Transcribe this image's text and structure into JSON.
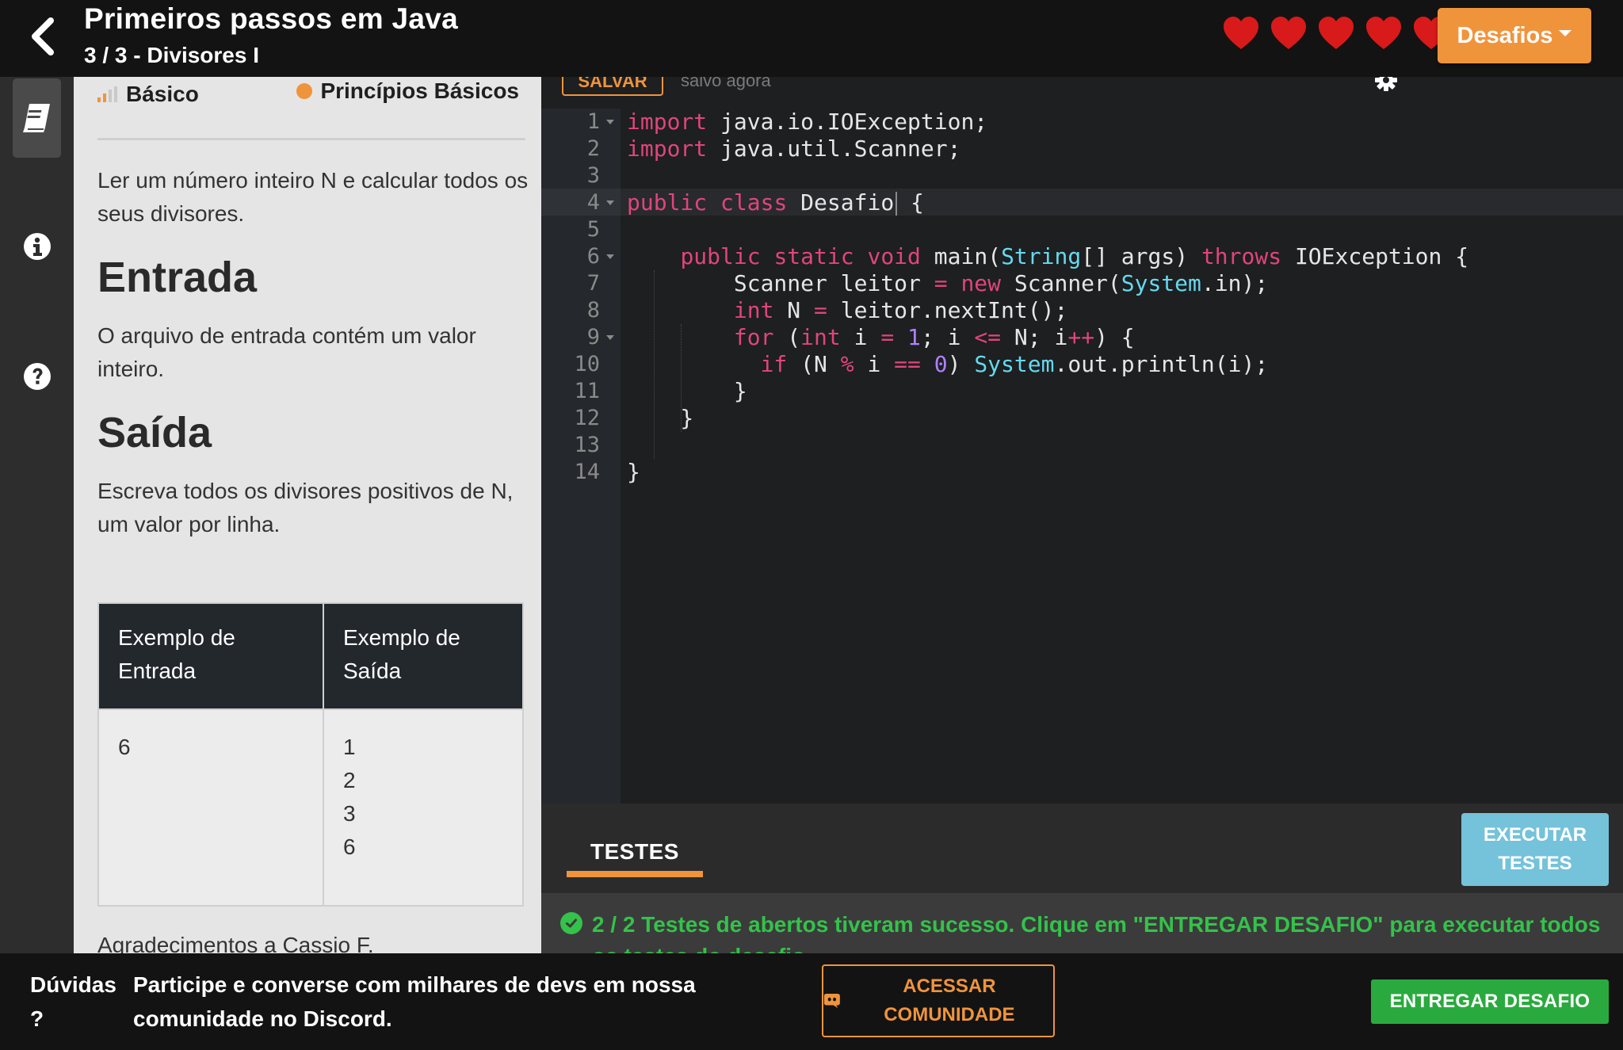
{
  "header": {
    "title": "Primeiros passos em Java",
    "subtitle": "3 / 3 - Divisores I",
    "hearts_count": 5,
    "heart_color": "#d91a1a",
    "desafios_label": "Desafios"
  },
  "rail": {
    "items": [
      {
        "icon": "book-icon",
        "active": true
      },
      {
        "icon": "info-icon",
        "active": false
      },
      {
        "icon": "question-icon",
        "active": false
      }
    ]
  },
  "problem": {
    "level_label": "Básico",
    "topic_label": "Princípios Básicos",
    "description": "Ler um número inteiro N e calcular todos os seus divisores.",
    "input_heading": "Entrada",
    "input_text": "O arquivo de entrada contém um valor inteiro.",
    "output_heading": "Saída",
    "output_text": "Escreva todos os divisores positivos de N, um valor por linha.",
    "example_table": {
      "headers": [
        "Exemplo de Entrada",
        "Exemplo de Saída"
      ],
      "input_lines": [
        "6"
      ],
      "output_lines": [
        "1",
        "2",
        "3",
        "6"
      ]
    },
    "thanks": "Agradecimentos a Cassio F."
  },
  "editor": {
    "save_label": "SALVAR",
    "saved_status": "salvo agora",
    "active_line": 4,
    "line_numbers": [
      "1",
      "2",
      "3",
      "4",
      "5",
      "6",
      "7",
      "8",
      "9",
      "10",
      "11",
      "12",
      "13",
      "14"
    ],
    "fold_lines": [
      1,
      4,
      6,
      9
    ],
    "code_lines": [
      "import java.io.IOException;",
      "import java.util.Scanner;",
      "",
      "public class Desafio {",
      "",
      "    public static void main(String[] args) throws IOException {",
      "        Scanner leitor = new Scanner(System.in);",
      "        int N = leitor.nextInt();",
      "        for (int i = 1; i <= N; i++) {",
      "          if (N % i == 0) System.out.println(i);",
      "        }",
      "    }",
      "",
      "}"
    ]
  },
  "tests": {
    "tab_label": "TESTES",
    "run_button_label": "EXECUTAR TESTES",
    "result_message": "2 / 2 Testes de abertos tiveram sucesso. Clique em \"ENTREGAR DESAFIO\" para executar todos os testes do desafio."
  },
  "footer": {
    "question_label": "Dúvidas ?",
    "discord_text": "Participe e converse com milhares de devs em nossa comunidade no Discord.",
    "community_button_label": "ACESSAR COMUNIDADE",
    "submit_button_label": "ENTREGAR DESAFIO"
  },
  "colors": {
    "accent_orange": "#f0943c",
    "success_green": "#34c24a",
    "submit_green": "#2aaa3e",
    "run_blue": "#75c2db"
  }
}
